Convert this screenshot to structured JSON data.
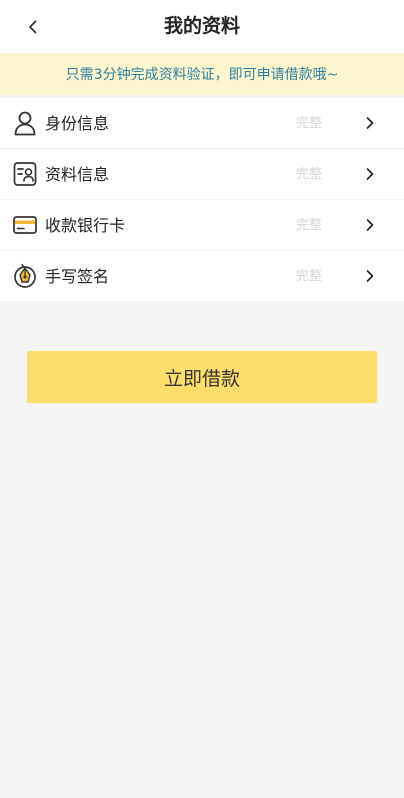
{
  "header": {
    "title": "我的资料"
  },
  "notice": {
    "text": "只需3分钟完成资料验证，即可申请借款哦~"
  },
  "items": [
    {
      "label": "身份信息",
      "status": "完整",
      "icon": "person-icon"
    },
    {
      "label": "资料信息",
      "status": "完整",
      "icon": "profile-card-icon"
    },
    {
      "label": "收款银行卡",
      "status": "完整",
      "icon": "bank-card-icon"
    },
    {
      "label": "手写签名",
      "status": "完整",
      "icon": "signature-pen-icon"
    }
  ],
  "submit": {
    "label": "立即借款"
  },
  "colors": {
    "accent": "#ffdd6b",
    "notice_bg": "#fdf5cc",
    "notice_text": "#2b7fa3",
    "status_text": "#d6d6d6",
    "page_bg": "#f5f4f5"
  }
}
